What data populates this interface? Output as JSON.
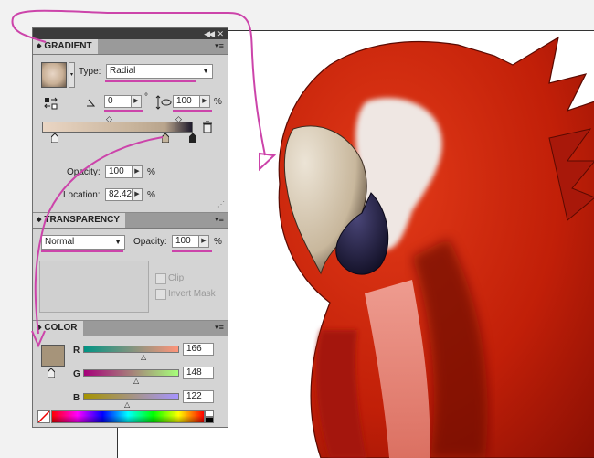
{
  "gradient_panel": {
    "title": "GRADIENT",
    "type_label": "Type:",
    "type_value": "Radial",
    "angle_value": "0",
    "degree_symbol": "°",
    "aspect_value": "100",
    "percent": "%",
    "opacity_label": "Opacity:",
    "opacity_value": "100",
    "location_label": "Location:",
    "location_value": "82.42"
  },
  "transparency_panel": {
    "title": "TRANSPARENCY",
    "blend_mode": "Normal",
    "opacity_label": "Opacity:",
    "opacity_value": "100",
    "percent": "%",
    "clip_label": "Clip",
    "invert_mask_label": "Invert Mask"
  },
  "color_panel": {
    "title": "COLOR",
    "r_label": "R",
    "g_label": "G",
    "b_label": "B",
    "r_value": "166",
    "g_value": "148",
    "b_value": "122",
    "swatch_color": "#a6947a"
  },
  "colors": {
    "annotation": "#cc44aa",
    "parrot_red": "#c0200a",
    "beak_light": "#d8cbb5",
    "beak_dark": "#1a1838"
  }
}
